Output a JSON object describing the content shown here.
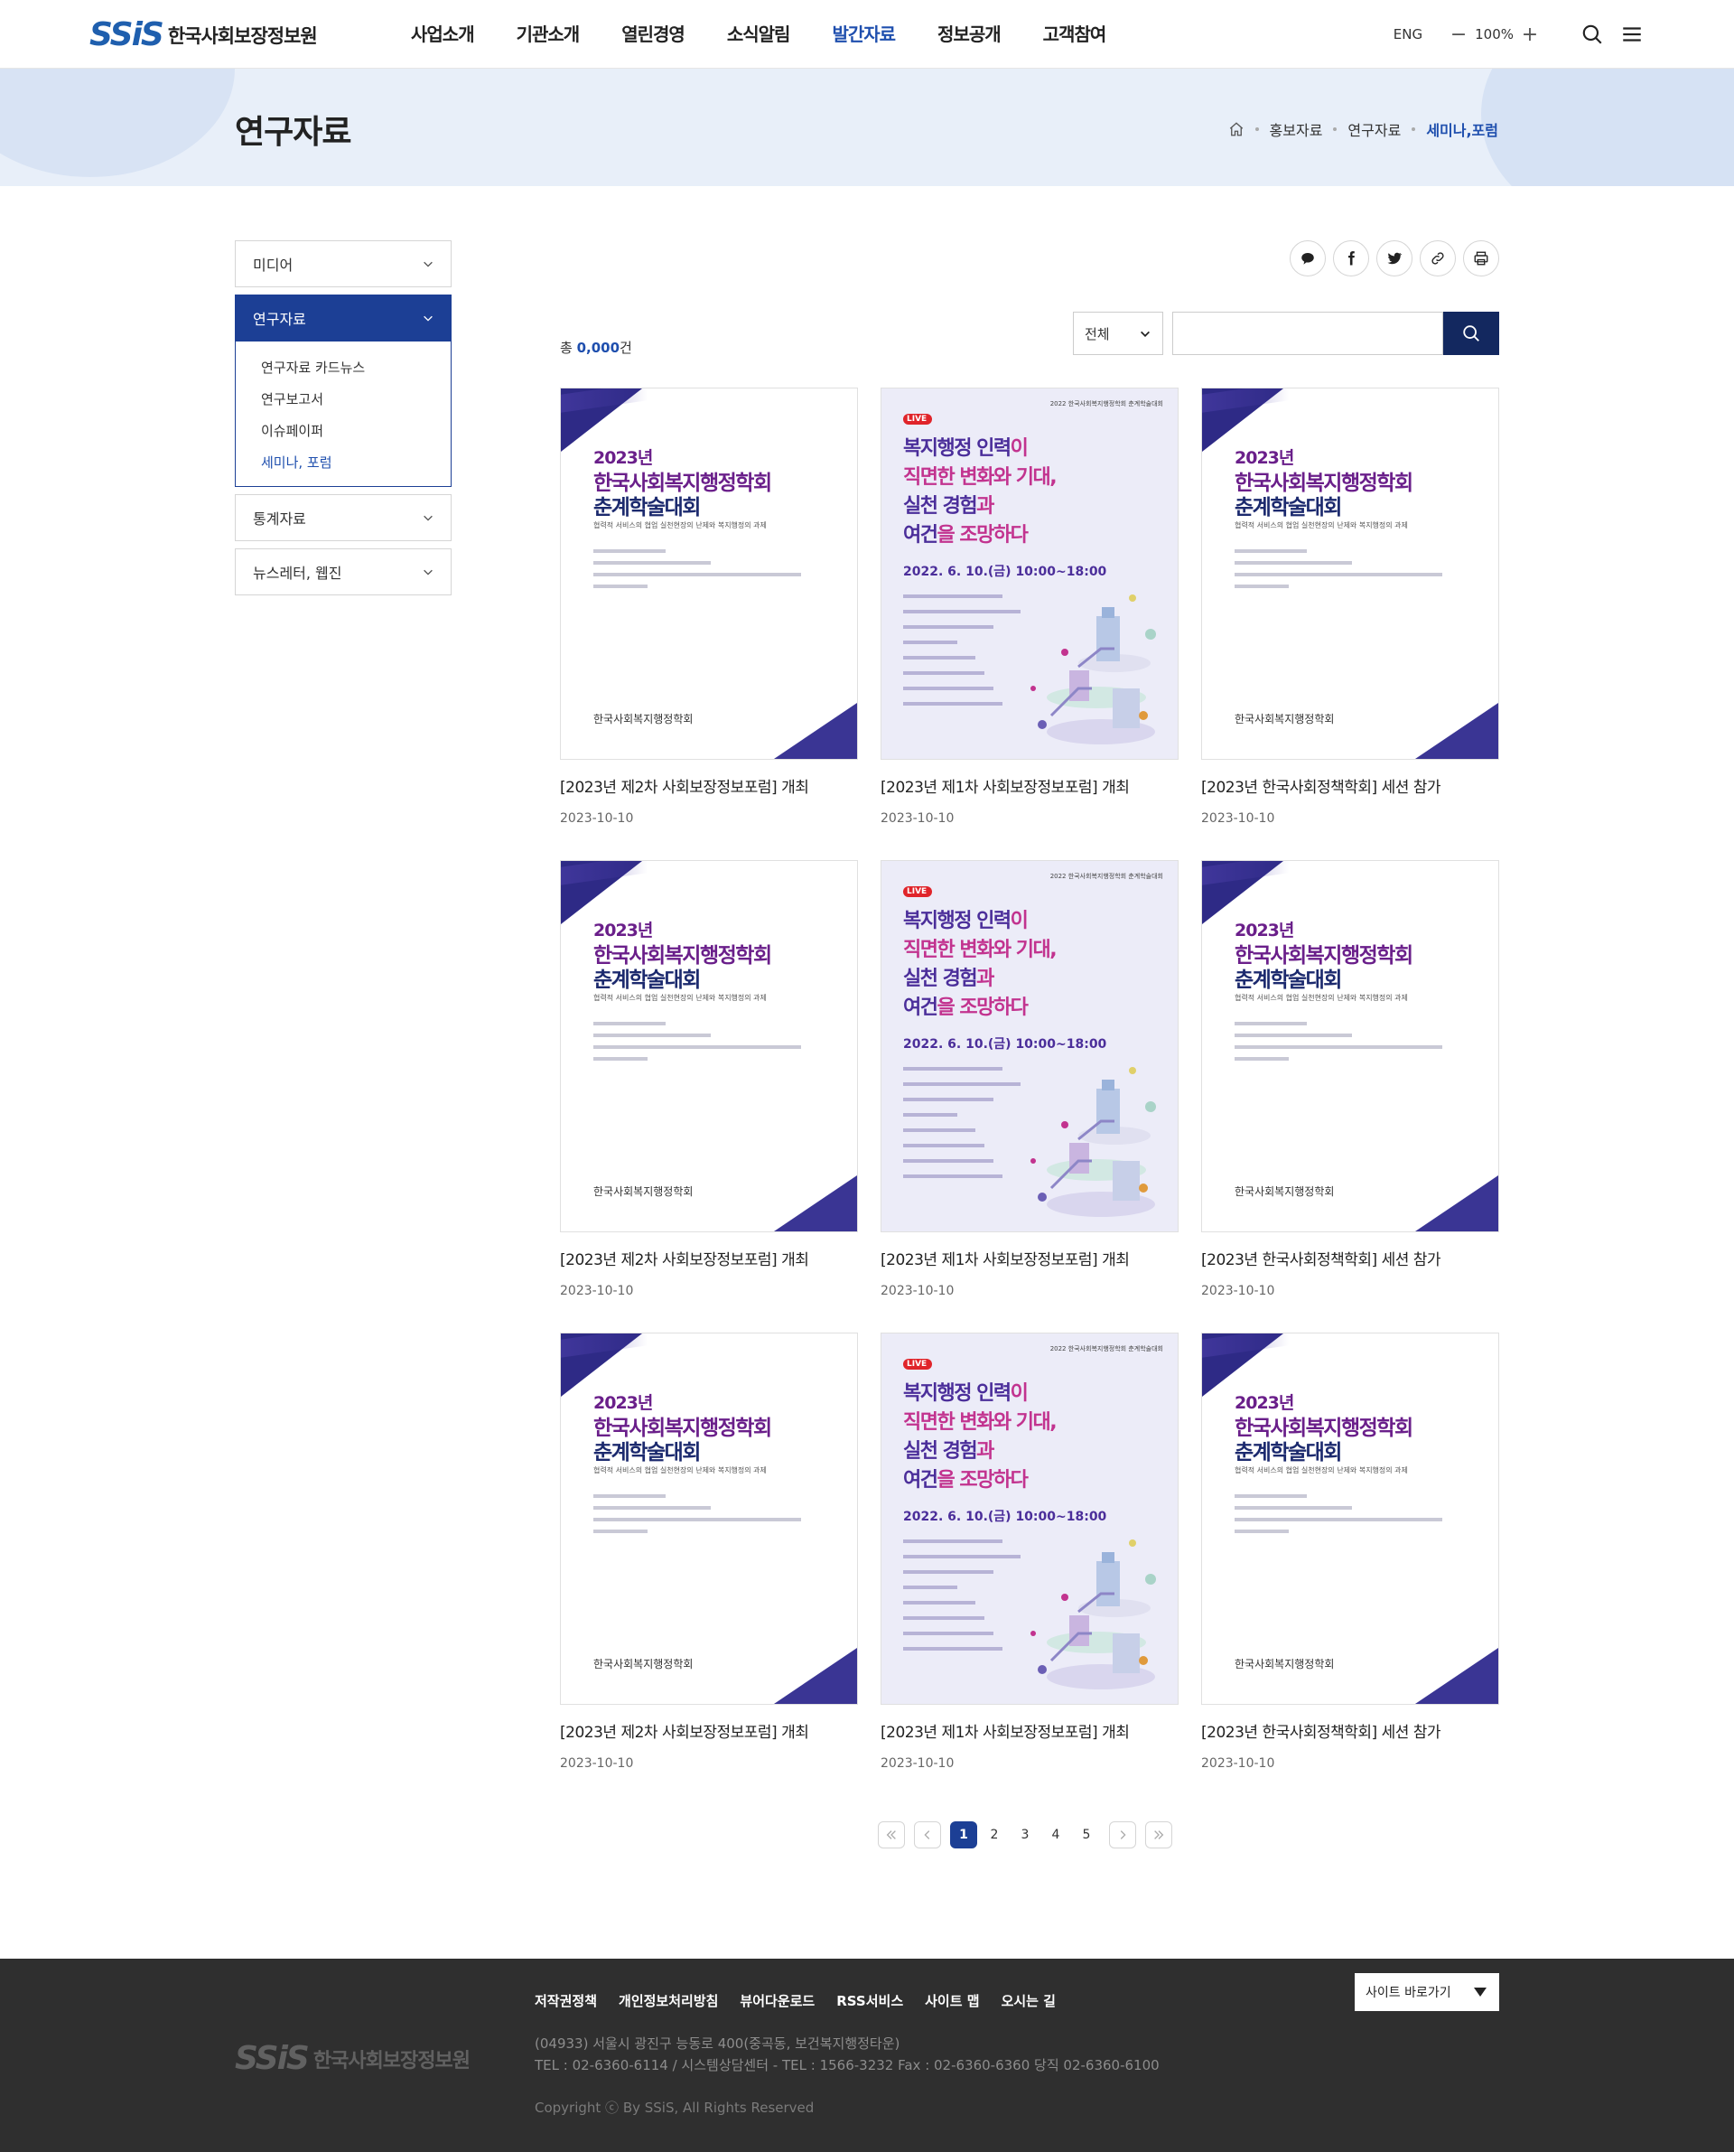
{
  "header": {
    "logo_mark": "SSiS",
    "logo_text": "한국사회보장정보원",
    "nav": [
      {
        "label": "사업소개"
      },
      {
        "label": "기관소개"
      },
      {
        "label": "열린경영"
      },
      {
        "label": "소식알림"
      },
      {
        "label": "발간자료",
        "active": true
      },
      {
        "label": "정보공개"
      },
      {
        "label": "고객참여"
      }
    ],
    "lang": "ENG",
    "zoom_value": "100%",
    "zoom_minus": "−",
    "zoom_plus": "+"
  },
  "subvisual": {
    "title": "연구자료",
    "breadcrumb": [
      "홍보자료",
      "연구자료",
      "세미나,포럼"
    ]
  },
  "lnb": {
    "items": [
      {
        "label": "미디어"
      },
      {
        "label": "연구자료",
        "open": true,
        "sub": [
          {
            "label": "연구자료 카드뉴스"
          },
          {
            "label": "연구보고서"
          },
          {
            "label": "이슈페이퍼"
          },
          {
            "label": "세미나, 포럼",
            "active": true
          }
        ]
      },
      {
        "label": "통계자료"
      },
      {
        "label": "뉴스레터, 웹진"
      }
    ]
  },
  "toolbar": {
    "total_prefix": "총 ",
    "total_count": "0,000",
    "total_suffix": "건",
    "search_select": "전체",
    "search_placeholder": ""
  },
  "posters": {
    "A": {
      "year": "2023년",
      "title1": "한국사회복지행정학회",
      "title2": "춘계학술대회",
      "subtitle": "협력적 서비스의 협업 실천현장의 난제와 복지행정의 과제",
      "org": "한국사회복지행정학회"
    },
    "B": {
      "top": "2022 한국사회복지행정학회 춘계학술대회",
      "live": "LIVE",
      "line1_a": "복지행정 인력",
      "line1_b": "이",
      "line2_a": "직면한 변화와 기대,",
      "line3_a": "실천 경험",
      "line3_b": "과",
      "line4_a": "여건",
      "line4_b": "을 조망",
      "line4_c": "하다",
      "date": "2022. 6. 10.(금) 10:00~18:00"
    }
  },
  "cards": [
    {
      "poster": "A",
      "title": "[2023년 제2차 사회보장정보포럼] 개최",
      "date": "2023-10-10"
    },
    {
      "poster": "B",
      "title": "[2023년 제1차 사회보장정보포럼] 개최",
      "date": "2023-10-10"
    },
    {
      "poster": "A",
      "title": "[2023년 한국사회정책학회] 세션 참가",
      "date": "2023-10-10"
    },
    {
      "poster": "A",
      "title": "[2023년 제2차 사회보장정보포럼] 개최",
      "date": "2023-10-10"
    },
    {
      "poster": "B",
      "title": "[2023년 제1차 사회보장정보포럼] 개최",
      "date": "2023-10-10"
    },
    {
      "poster": "A",
      "title": "[2023년 한국사회정책학회] 세션 참가",
      "date": "2023-10-10"
    },
    {
      "poster": "A",
      "title": "[2023년 제2차 사회보장정보포럼] 개최",
      "date": "2023-10-10"
    },
    {
      "poster": "B",
      "title": "[2023년 제1차 사회보장정보포럼] 개최",
      "date": "2023-10-10"
    },
    {
      "poster": "A",
      "title": "[2023년 한국사회정책학회] 세션 참가",
      "date": "2023-10-10"
    }
  ],
  "pagination": {
    "pages": [
      "1",
      "2",
      "3",
      "4",
      "5"
    ],
    "current": "1"
  },
  "footer": {
    "links": [
      "저작권정책",
      "개인정보처리방침",
      "뷰어다운로드",
      "RSS서비스",
      "사이트 맵",
      "오시는 길"
    ],
    "address": "(04933) 서울시 광진구 능동로 400(중곡동, 보건복지행정타운)",
    "tel": "TEL : 02-6360-6114 / 시스템상담센터 - TEL : 1566-3232  Fax : 02-6360-6360  당직 02-6360-6100",
    "copyright": "Copyright ⓒ By SSiS, All Rights Reserved",
    "family_site": "사이트 바로가기",
    "logo_mark": "SSiS",
    "logo_text": "한국사회보장정보원"
  },
  "colors": {
    "primary": "#1c3f95",
    "accent_text": "#1f4fae",
    "search_button": "#13285f",
    "footer_bg": "#2f2f2f",
    "subvisual_bg": "#e8eff9"
  },
  "icons": {
    "header": [
      "search-icon",
      "menu-icon",
      "home-icon"
    ],
    "share": [
      "kakao-talk-icon",
      "facebook-icon",
      "twitter-icon",
      "link-icon",
      "print-icon"
    ]
  }
}
